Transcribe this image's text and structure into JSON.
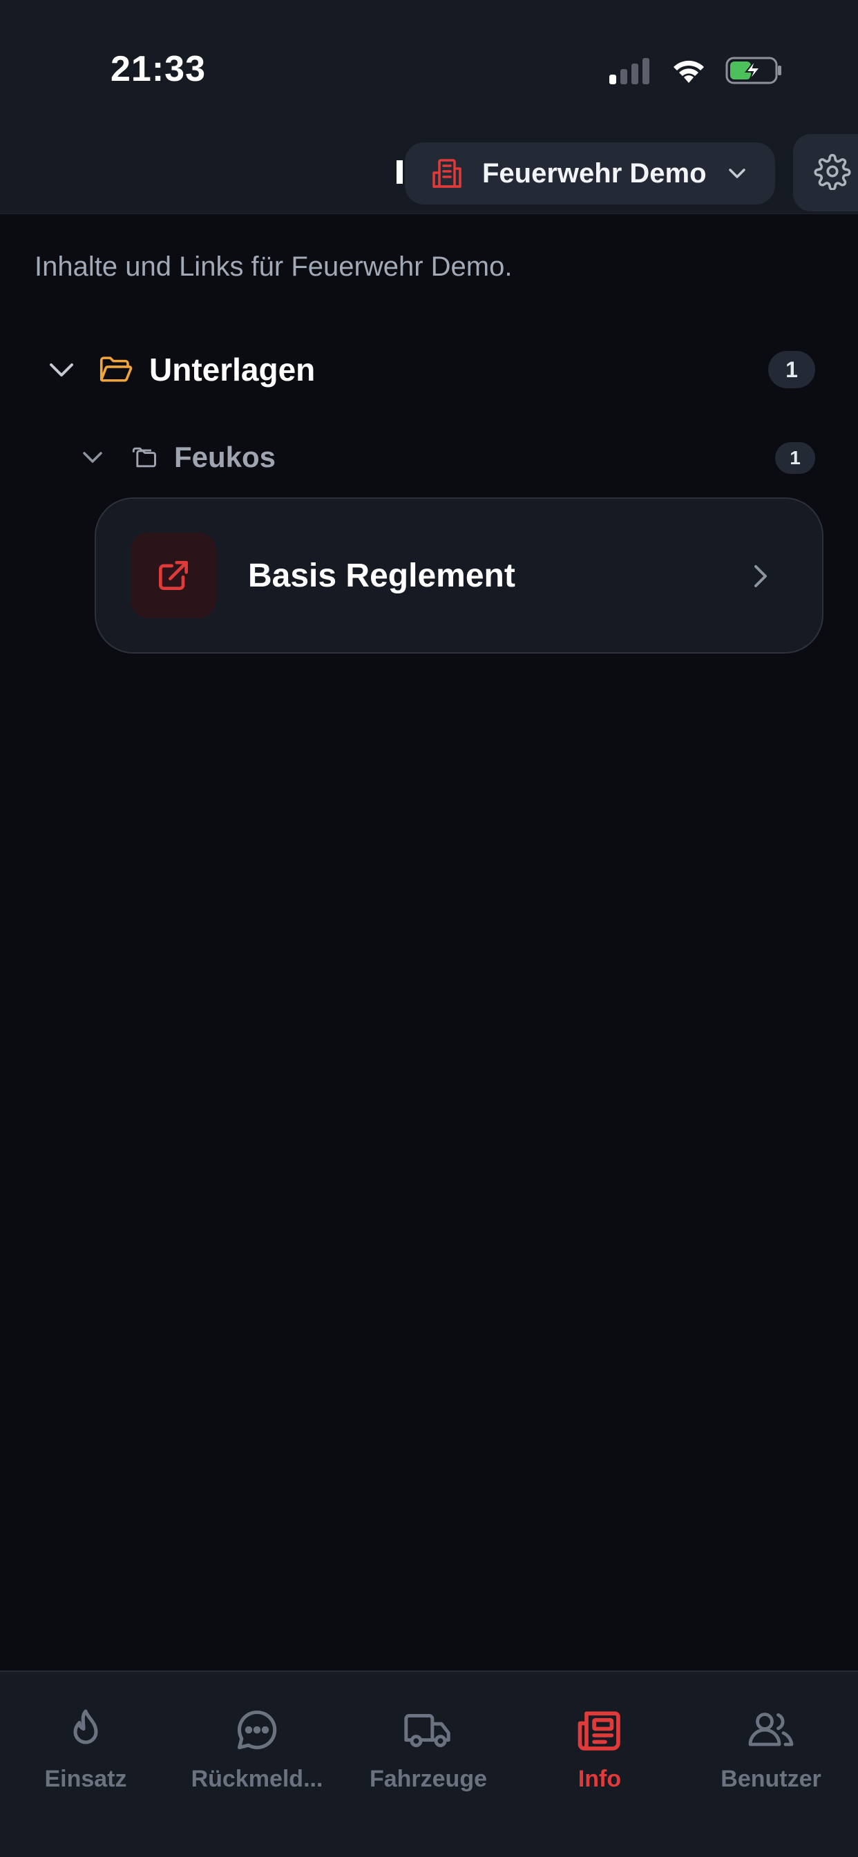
{
  "status_bar": {
    "time": "21:33"
  },
  "header": {
    "org_name": "Feuerwehr Demo"
  },
  "intro_text": "Inhalte und Links für Feuerwehr Demo.",
  "folders": [
    {
      "title": "Unterlagen",
      "count": "1",
      "subfolders": [
        {
          "title": "Feukos",
          "count": "1",
          "links": [
            {
              "title": "Basis Reglement"
            }
          ]
        }
      ]
    }
  ],
  "tabs": [
    {
      "label": "Einsatz",
      "icon": "flame-icon"
    },
    {
      "label": "Rückmeld...",
      "icon": "chat-bubble-icon"
    },
    {
      "label": "Fahrzeuge",
      "icon": "truck-icon"
    },
    {
      "label": "Info",
      "icon": "newspaper-icon",
      "active": true
    },
    {
      "label": "Benutzer",
      "icon": "users-icon"
    }
  ],
  "colors": {
    "accent": "#e03a3a",
    "folder": "#f0a63a",
    "background": "#0b0c11",
    "surface": "#161a23",
    "inactive": "#6b7280"
  }
}
